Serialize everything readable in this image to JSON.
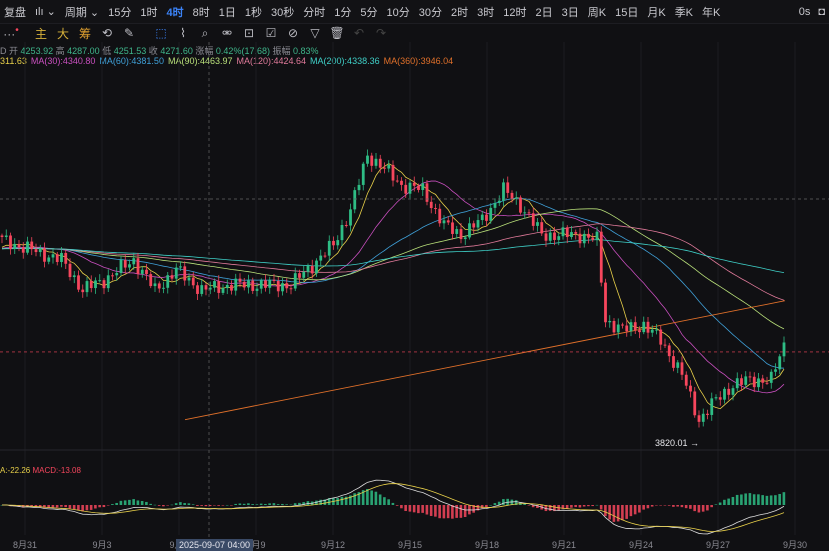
{
  "toolbar": {
    "left_label": "复盘",
    "chart_type_icon": "candles-icon",
    "period_label": "周期",
    "intervals": [
      "15分",
      "1时",
      "4时",
      "8时",
      "1日",
      "1秒",
      "30秒",
      "分时",
      "1分",
      "5分",
      "10分",
      "30分",
      "2时",
      "3时",
      "12时",
      "2日",
      "3日",
      "周K",
      "15日",
      "月K",
      "季K",
      "年K"
    ],
    "active_interval": "4时",
    "right_status": "0s"
  },
  "tools": {
    "more": "···",
    "indicators": [
      "主",
      "大",
      "筹"
    ],
    "icons": [
      "sync-icon",
      "pen-icon",
      "select-icon",
      "ruler-icon",
      "magnet-icon",
      "measure-icon",
      "lock-icon",
      "note-icon",
      "hide-icon",
      "filter-icon",
      "trash-icon",
      "undo-icon",
      "redo-icon"
    ]
  },
  "info": {
    "prefix": "D",
    "open_label": "开",
    "open": "4253.92",
    "high_label": "高",
    "high": "4287.00",
    "low_label": "低",
    "low": "4251.53",
    "close_label": "收",
    "close": "4271.60",
    "change_label": "涨幅",
    "change": "0.42%(17.68)",
    "amp_label": "振幅",
    "amp": "0.83%"
  },
  "ma": [
    {
      "t": "311.63",
      "c": "#e8d04a"
    },
    {
      "t": "MA(30):4340.80",
      "c": "#c94fbf"
    },
    {
      "t": "MA(60):4381.50",
      "c": "#3fa0d8"
    },
    {
      "t": "MA(90):4463.97",
      "c": "#b9e07a"
    },
    {
      "t": "MA(120):4424.64",
      "c": "#e07a9a"
    },
    {
      "t": "MA(200):4338.36",
      "c": "#3fd0c8"
    },
    {
      "t": "MA(360):3946.04",
      "c": "#e0702a"
    }
  ],
  "macd": {
    "dea": "A:-22.26",
    "macd": "MACD:-13.08"
  },
  "cursor_date": "2025-09-07 04:00",
  "low_marker": "3820.01 →",
  "chart_data": {
    "type": "candlestick",
    "up_color": "#2ebd85",
    "down_color": "#f6465d",
    "ylim": [
      3700,
      5000
    ],
    "key_closes": [
      [
        0,
        4449
      ],
      [
        7,
        4416
      ],
      [
        14,
        4384
      ],
      [
        19,
        4285
      ],
      [
        24,
        4318
      ],
      [
        31,
        4384
      ],
      [
        36,
        4285
      ],
      [
        41,
        4351
      ],
      [
        47,
        4285
      ],
      [
        54,
        4302
      ],
      [
        61,
        4302
      ],
      [
        68,
        4302
      ],
      [
        73,
        4367
      ],
      [
        78,
        4433
      ],
      [
        82,
        4548
      ],
      [
        86,
        4728
      ],
      [
        89,
        4695
      ],
      [
        94,
        4630
      ],
      [
        99,
        4613
      ],
      [
        104,
        4498
      ],
      [
        108,
        4466
      ],
      [
        113,
        4515
      ],
      [
        118,
        4613
      ],
      [
        122,
        4564
      ],
      [
        127,
        4466
      ],
      [
        132,
        4466
      ],
      [
        136,
        4466
      ],
      [
        140,
        4449
      ],
      [
        142,
        4187
      ],
      [
        146,
        4154
      ],
      [
        151,
        4170
      ],
      [
        155,
        4121
      ],
      [
        160,
        4006
      ],
      [
        164,
        3859
      ],
      [
        168,
        3924
      ],
      [
        172,
        3974
      ],
      [
        176,
        3990
      ],
      [
        181,
        3990
      ],
      [
        184,
        4105
      ]
    ],
    "ma360_range": [
      3860,
      4250
    ],
    "current_price": 4105,
    "x_ticks": [
      "8月31",
      "9月3",
      "9月6",
      "9月9",
      "9月12",
      "9月15",
      "9月18",
      "9月21",
      "9月24",
      "9月27",
      "9月30"
    ]
  }
}
